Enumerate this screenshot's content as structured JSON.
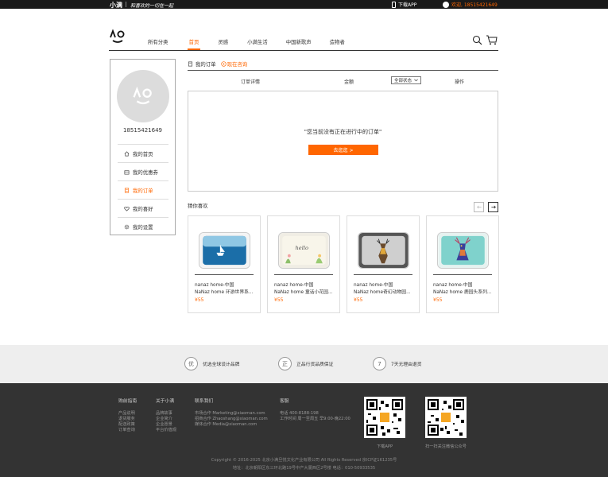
{
  "topbar": {
    "brand": "小满",
    "slogan": "和喜欢的一切在一起",
    "app_label": "下载APP",
    "welcome": "欢迎, 18515421649"
  },
  "nav": {
    "items": [
      "所有分类",
      "首页",
      "灵感",
      "小满生活",
      "中国新歌声",
      "造物者"
    ],
    "active_index": 1
  },
  "user": {
    "phone": "18515421649"
  },
  "sidebar": {
    "items": [
      "我的首页",
      "我的优惠券",
      "我的订单",
      "我的喜好",
      "我的设置"
    ],
    "active_index": 2
  },
  "orders": {
    "title": "我的订单",
    "consult": "现在咨询",
    "col_detail": "订单详情",
    "col_amount": "金额",
    "status_selected": "全部状态",
    "col_action": "操作",
    "empty_text": "\"您当前没有正在进行中的订单\"",
    "go_button": "去逛逛 >"
  },
  "guess": {
    "title": "猜你喜欢",
    "products": [
      {
        "brand": "nanaz home-中国",
        "name": "NaNaz home 环游世界系...",
        "price": "¥55"
      },
      {
        "brand": "nanaz home-中国",
        "name": "NaNaz home 童话小花园...",
        "price": "¥55"
      },
      {
        "brand": "nanaz home-中国",
        "name": "NaNaz home奇幻动物园...",
        "price": "¥55"
      },
      {
        "brand": "nanaz home-中国",
        "name": "NaNaz home 鹿园头系列...",
        "price": "¥55"
      }
    ]
  },
  "promise": {
    "items": [
      {
        "glyph": "优",
        "text": "优选全球设计品牌"
      },
      {
        "glyph": "正",
        "text": "正品行货品质保证"
      },
      {
        "glyph": "7",
        "text": "7天无理由退货"
      }
    ]
  },
  "footer": {
    "col1": {
      "title": "购前指南",
      "items": [
        "产品说明",
        "退货服务",
        "配送政策",
        "订单查询"
      ]
    },
    "col2": {
      "title": "关于小满",
      "items": [
        "品牌故事",
        "企业简介",
        "企业愿景",
        "平台价值观"
      ]
    },
    "col3": {
      "title": "联系我们",
      "items": [
        "市场合作 Marketing@xiaoman.com",
        "招商合作 Zhaoshang@xiaoman.com",
        "媒体合作 Media@xiaoman.com"
      ]
    },
    "col4": {
      "title": "客服",
      "items": [
        "电话 400-8188-198",
        "工作时间 周一至周五 早9:00-晚22:00"
      ]
    },
    "qr1_label": "下载APP",
    "qr2_label": "扫一扫关注微信公众号",
    "copyright": "Copyright © 2016-2025 北京小满旦悦文化产业有限公司 All Rights Reserved  京ICP证161235号",
    "address": "地址：北京朝阳区东三环北路19号中产大厦西区2号楼        电话：010-50933535"
  }
}
